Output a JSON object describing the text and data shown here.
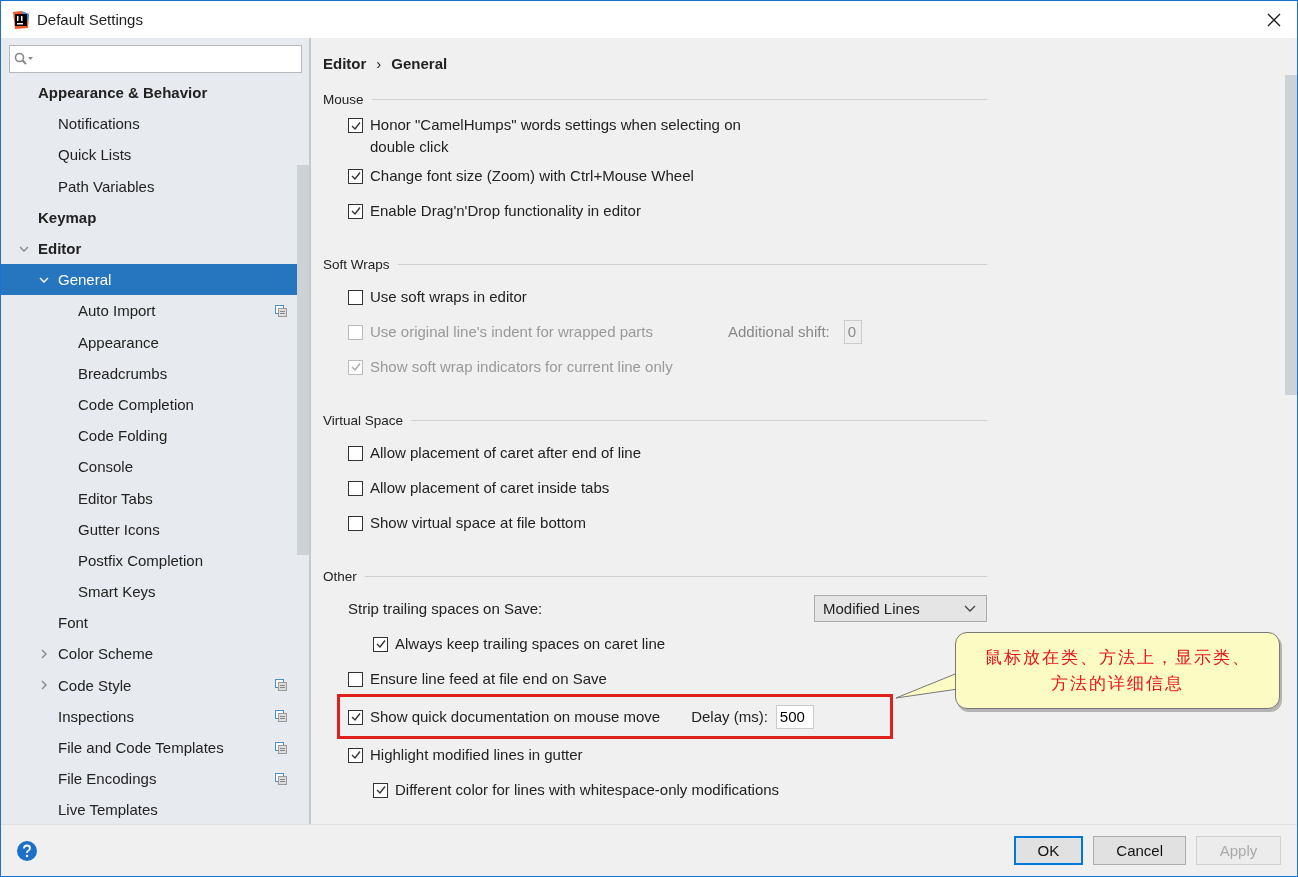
{
  "window": {
    "title": "Default Settings"
  },
  "sidebar": {
    "items": [
      {
        "label": "Appearance & Behavior",
        "bold": true,
        "children": [
          {
            "label": "Notifications",
            "selected": false
          },
          {
            "label": "Quick Lists",
            "selected": false
          },
          {
            "label": "Path Variables",
            "selected": false
          }
        ],
        "selected": false
      },
      {
        "label": "Keymap",
        "bold": true,
        "selected": false
      },
      {
        "label": "Editor",
        "bold": true,
        "expanded": true,
        "selected": false,
        "children": [
          {
            "label": "General",
            "expanded": true,
            "selected": true,
            "children": [
              {
                "label": "Auto Import",
                "selected": false,
                "project_icon": true
              },
              {
                "label": "Appearance",
                "selected": false
              },
              {
                "label": "Breadcrumbs",
                "selected": false
              },
              {
                "label": "Code Completion",
                "selected": false
              },
              {
                "label": "Code Folding",
                "selected": false
              },
              {
                "label": "Console",
                "selected": false
              },
              {
                "label": "Editor Tabs",
                "selected": false
              },
              {
                "label": "Gutter Icons",
                "selected": false
              },
              {
                "label": "Postfix Completion",
                "selected": false
              },
              {
                "label": "Smart Keys",
                "selected": false
              }
            ]
          },
          {
            "label": "Font",
            "selected": false
          },
          {
            "label": "Color Scheme",
            "expanded": false,
            "selected": false
          },
          {
            "label": "Code Style",
            "expanded": false,
            "selected": false,
            "project_icon": true
          },
          {
            "label": "Inspections",
            "selected": false,
            "project_icon": true
          },
          {
            "label": "File and Code Templates",
            "selected": false,
            "project_icon": true
          },
          {
            "label": "File Encodings",
            "selected": false,
            "project_icon": true
          },
          {
            "label": "Live Templates",
            "selected": false
          }
        ]
      }
    ]
  },
  "breadcrumb": [
    "Editor",
    "›",
    "General"
  ],
  "sections": [
    {
      "title": "Mouse",
      "rows": [
        {
          "kind": "checkbox",
          "label": "Honor \"CamelHumps\" words settings when selecting on double click",
          "checked": true,
          "disabled": false
        },
        {
          "kind": "checkbox",
          "label": "Change font size (Zoom) with Ctrl+Mouse Wheel",
          "checked": true,
          "disabled": false
        },
        {
          "kind": "checkbox",
          "label": "Enable Drag'n'Drop functionality in editor",
          "checked": true,
          "disabled": false
        }
      ]
    },
    {
      "title": "Soft Wraps",
      "rows": [
        {
          "kind": "checkbox",
          "label": "Use soft wraps in editor",
          "checked": false,
          "disabled": false
        },
        {
          "kind": "checkbox",
          "label": "Use original line's indent for wrapped parts",
          "checked": false,
          "disabled": true,
          "field_label": "Additional shift:",
          "field_value": "0"
        },
        {
          "kind": "checkbox",
          "label": "Show soft wrap indicators for current line only",
          "checked": true,
          "disabled": true
        }
      ]
    },
    {
      "title": "Virtual Space",
      "rows": [
        {
          "kind": "checkbox",
          "label": "Allow placement of caret after end of line",
          "checked": false,
          "disabled": false
        },
        {
          "kind": "checkbox",
          "label": "Allow placement of caret inside tabs",
          "checked": false,
          "disabled": false
        },
        {
          "kind": "checkbox",
          "label": "Show virtual space at file bottom",
          "checked": false,
          "disabled": false
        }
      ]
    },
    {
      "title": "Other",
      "rows": [
        {
          "kind": "select",
          "label": "Strip trailing spaces on Save:",
          "value": "Modified Lines",
          "children": [
            {
              "kind": "checkbox",
              "label": "Always keep trailing spaces on caret line",
              "checked": true,
              "disabled": false
            }
          ]
        },
        {
          "kind": "checkbox",
          "label": "Ensure line feed at file end on Save",
          "checked": false,
          "disabled": false
        },
        {
          "kind": "checkbox",
          "label": "Show quick documentation on mouse move",
          "checked": true,
          "disabled": false,
          "highlighted": true,
          "field_label": "Delay (ms):",
          "field_value": "500"
        },
        {
          "kind": "checkbox",
          "label": "Highlight modified lines in gutter",
          "checked": true,
          "disabled": false,
          "children": [
            {
              "kind": "checkbox",
              "label": "Different color for lines with whitespace-only modifications",
              "checked": true,
              "disabled": false
            }
          ]
        }
      ]
    }
  ],
  "callout": {
    "text": "鼠标放在类、方法上，显示类、方法的详细信息"
  },
  "buttons": [
    {
      "label": "OK",
      "default": true,
      "disabled": false
    },
    {
      "label": "Cancel",
      "default": false,
      "disabled": false
    },
    {
      "label": "Apply",
      "default": false,
      "disabled": true
    }
  ]
}
